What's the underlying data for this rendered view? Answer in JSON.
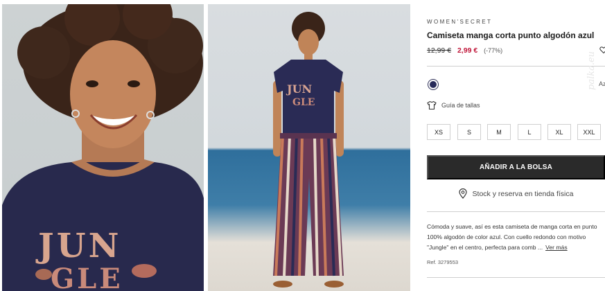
{
  "colors": {
    "accent_price": "#c0173a",
    "button_bg": "#2a2a2a",
    "swatch_navy": "#272a5a"
  },
  "gallery": {
    "photo1_alt": "",
    "photo2_alt": ""
  },
  "product": {
    "brand": "WOMEN'SECRET",
    "title": "Camiseta manga corta punto algodón azul",
    "price_old": "12,99 €",
    "price_new": "2,99 €",
    "discount": "(-77%)",
    "wishlist_icon": "heart-icon",
    "color_name": "Az",
    "size_guide_label": "Guía de tallas",
    "size_guide_icon": "tshirt-icon",
    "sizes": [
      "XS",
      "S",
      "M",
      "L",
      "XL",
      "XXL"
    ],
    "add_to_bag_label": "AÑADIR A LA BOLSA",
    "stock_label": "Stock y reserva en tienda física",
    "stock_icon": "location-pin-icon",
    "description": "Cómoda y suave, así es esta camiseta de manga corta en punto 100% algodón de color azul. Con cuello redondo con motivo \"Jungle\" en el centro, perfecta para comb ...",
    "see_more_label": "Ver más",
    "reference": "Ref. 3279553",
    "watermark": "palka.eu"
  }
}
